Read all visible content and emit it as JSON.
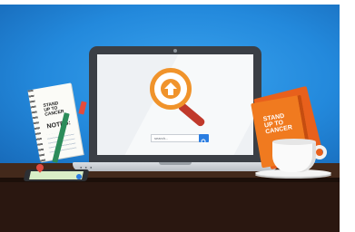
{
  "scene": {
    "notepad": {
      "logo_line1": "STAND",
      "logo_line2": "UP TO",
      "logo_line3": "CANCER",
      "notes_label": "NOTES:"
    },
    "laptop": {
      "search_text": "search..."
    },
    "book": {
      "title_line1": "STAND",
      "title_line2": "UP TO",
      "title_line3": "CANCER"
    }
  },
  "colors": {
    "wall": "#2389dc",
    "accent_orange": "#f0932b",
    "magnifier_handle": "#c0392b",
    "search_button": "#2a7de1"
  },
  "icons": {
    "magnifier": "upload-arrow-magnifier-icon",
    "search_button": "search-icon"
  }
}
